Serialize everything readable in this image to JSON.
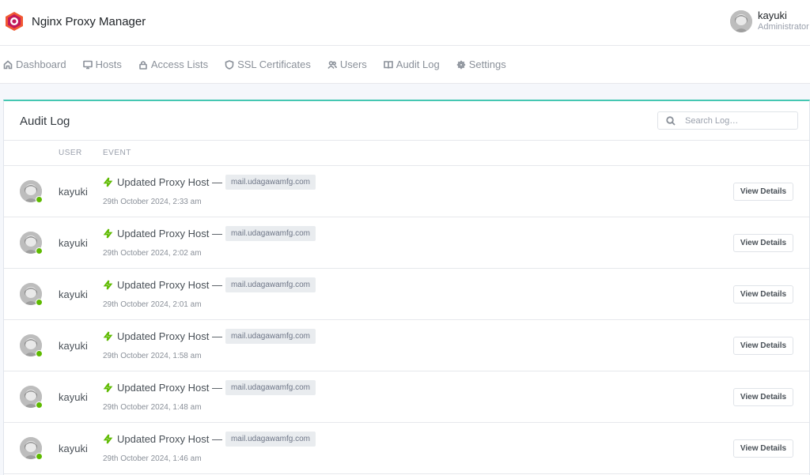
{
  "app": {
    "title": "Nginx Proxy Manager"
  },
  "current_user": {
    "name": "kayuki",
    "role": "Administrator"
  },
  "nav": [
    {
      "label": "Dashboard",
      "icon": "home-icon"
    },
    {
      "label": "Hosts",
      "icon": "monitor-icon"
    },
    {
      "label": "Access Lists",
      "icon": "lock-icon"
    },
    {
      "label": "SSL Certificates",
      "icon": "shield-icon"
    },
    {
      "label": "Users",
      "icon": "users-icon"
    },
    {
      "label": "Audit Log",
      "icon": "book-icon"
    },
    {
      "label": "Settings",
      "icon": "gear-icon"
    }
  ],
  "card": {
    "title": "Audit Log",
    "search_placeholder": "Search Log…",
    "columns": {
      "user": "USER",
      "event": "EVENT"
    },
    "button_label": "View Details"
  },
  "rows": [
    {
      "user": "kayuki",
      "event": "Updated Proxy Host —",
      "host": "mail.udagawamfg.com",
      "time": "29th October 2024, 2:33 am"
    },
    {
      "user": "kayuki",
      "event": "Updated Proxy Host —",
      "host": "mail.udagawamfg.com",
      "time": "29th October 2024, 2:02 am"
    },
    {
      "user": "kayuki",
      "event": "Updated Proxy Host —",
      "host": "mail.udagawamfg.com",
      "time": "29th October 2024, 2:01 am"
    },
    {
      "user": "kayuki",
      "event": "Updated Proxy Host —",
      "host": "mail.udagawamfg.com",
      "time": "29th October 2024, 1:58 am"
    },
    {
      "user": "kayuki",
      "event": "Updated Proxy Host —",
      "host": "mail.udagawamfg.com",
      "time": "29th October 2024, 1:48 am"
    },
    {
      "user": "kayuki",
      "event": "Updated Proxy Host —",
      "host": "mail.udagawamfg.com",
      "time": "29th October 2024, 1:46 am"
    }
  ],
  "colors": {
    "accent": "#45c7b2",
    "online": "#5eba00",
    "event_icon": "#5eba00"
  }
}
